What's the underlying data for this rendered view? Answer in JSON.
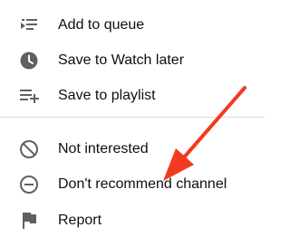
{
  "menu": {
    "items": [
      {
        "label": "Add to queue",
        "icon": "add-to-queue-icon"
      },
      {
        "label": "Save to Watch later",
        "icon": "clock-icon"
      },
      {
        "label": "Save to playlist",
        "icon": "playlist-add-icon"
      },
      {
        "label": "Not interested",
        "icon": "block-icon"
      },
      {
        "label": "Don't recommend channel",
        "icon": "remove-circle-icon"
      },
      {
        "label": "Report",
        "icon": "flag-icon"
      }
    ]
  },
  "colors": {
    "icon": "#606060",
    "text": "#0f0f0f",
    "divider": "#dcdcdc",
    "annotation_arrow": "#f23a1e"
  }
}
